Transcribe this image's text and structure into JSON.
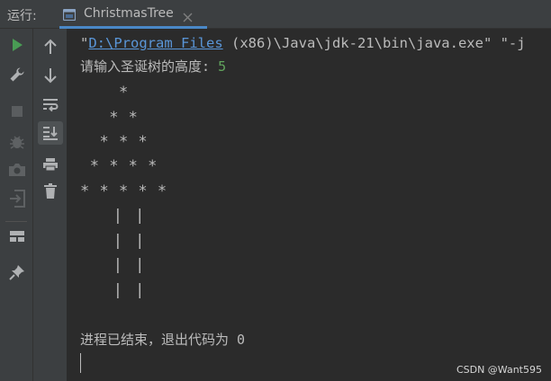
{
  "header": {
    "run_label": "运行:",
    "tab_title": "ChristmasTree",
    "tab_icon": "console-window-icon",
    "close_icon": "close-icon"
  },
  "left_toolbar": [
    {
      "name": "rerun-button",
      "icon": "play-icon",
      "color": "#499c54"
    },
    {
      "name": "edit-configuration-button",
      "icon": "wrench-icon"
    },
    {
      "name": "stop-button",
      "icon": "stop-icon"
    },
    {
      "name": "debug-button",
      "icon": "bug-icon"
    },
    {
      "name": "screenshot-button",
      "icon": "camera-icon"
    },
    {
      "name": "exit-button",
      "icon": "exit-icon"
    },
    {
      "name": "layout-button",
      "icon": "layout-icon"
    },
    {
      "name": "pin-tab-button",
      "icon": "pin-icon"
    }
  ],
  "right_toolbar": [
    {
      "name": "scroll-up-button",
      "icon": "arrow-up-icon"
    },
    {
      "name": "scroll-down-button",
      "icon": "arrow-down-icon"
    },
    {
      "name": "soft-wrap-button",
      "icon": "soft-wrap-icon"
    },
    {
      "name": "scroll-to-end-button",
      "icon": "scroll-to-end-icon",
      "active": true
    },
    {
      "name": "print-button",
      "icon": "printer-icon"
    },
    {
      "name": "clear-all-button",
      "icon": "trash-icon"
    }
  ],
  "console": {
    "command": {
      "prefix": "\"",
      "link": "D:\\Program Files",
      "rest": " (x86)\\Java\\jdk-21\\bin\\java.exe\" \"-j"
    },
    "prompt": "请输入圣诞树的高度: ",
    "input_value": "5",
    "tree_lines": [
      "    *",
      "   * *",
      "  * * *",
      " * * * *",
      "* * * * *"
    ],
    "trunk_lines": [
      "   | |",
      "   | |",
      "   | |",
      "   | |"
    ],
    "exit_message": "进程已结束，退出代码为 0"
  },
  "colors": {
    "background": "#2b2b2b",
    "panel": "#3c3f41",
    "text": "#bbbbbb",
    "link": "#5a96d8",
    "input": "#62a55d",
    "tab_underline": "#4a88c7",
    "run_green": "#499c54"
  },
  "watermark": "CSDN @Want595"
}
